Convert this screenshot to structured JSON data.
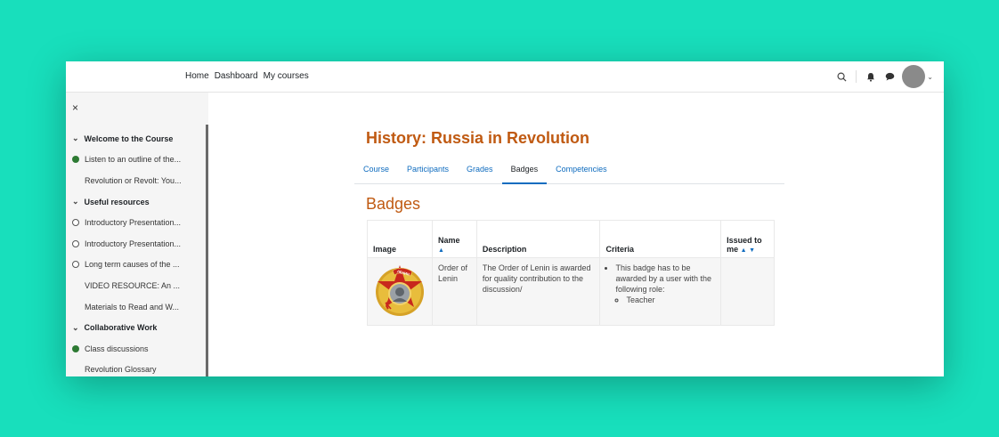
{
  "navbar": {
    "links": [
      "Home",
      "Dashboard",
      "My courses"
    ]
  },
  "drawer": {
    "close_label": "×",
    "items": [
      {
        "type": "section",
        "label": "Welcome to the Course"
      },
      {
        "type": "item",
        "label": "Listen to an outline of the...",
        "status": "done"
      },
      {
        "type": "item",
        "label": "Revolution or Revolt: You...",
        "status": "none"
      },
      {
        "type": "section",
        "label": "Useful resources"
      },
      {
        "type": "item",
        "label": "Introductory Presentation...",
        "status": "open"
      },
      {
        "type": "item",
        "label": "Introductory Presentation...",
        "status": "open"
      },
      {
        "type": "item",
        "label": "Long term causes of the ...",
        "status": "open"
      },
      {
        "type": "item",
        "label": "VIDEO RESOURCE: An ...",
        "status": "none"
      },
      {
        "type": "item",
        "label": "Materials to Read and W...",
        "status": "none"
      },
      {
        "type": "section",
        "label": "Collaborative Work"
      },
      {
        "type": "item",
        "label": "Class discussions",
        "status": "done"
      },
      {
        "type": "item",
        "label": "Revolution Glossary",
        "status": "none"
      }
    ]
  },
  "main": {
    "course_title": "History: Russia in Revolution",
    "tabs": [
      {
        "label": "Course",
        "active": false
      },
      {
        "label": "Participants",
        "active": false
      },
      {
        "label": "Grades",
        "active": false
      },
      {
        "label": "Badges",
        "active": true
      },
      {
        "label": "Competencies",
        "active": false
      }
    ],
    "badges_heading": "Badges",
    "table": {
      "headers": {
        "image": "Image",
        "name": "Name",
        "description": "Description",
        "criteria": "Criteria",
        "issued": "Issued to me"
      },
      "rows": [
        {
          "image": "order-of-lenin-medal",
          "name": "Order of Lenin",
          "description": "The Order of Lenin is awarded for quality contribution to the discussion/",
          "criteria_intro": "This badge has to be awarded by a user with the following role:",
          "criteria_role": "Teacher",
          "issued": ""
        }
      ]
    }
  },
  "colors": {
    "background": "#18dfbc",
    "accent": "#c05a12",
    "link": "#0f6cbf",
    "complete": "#2d7a33"
  }
}
